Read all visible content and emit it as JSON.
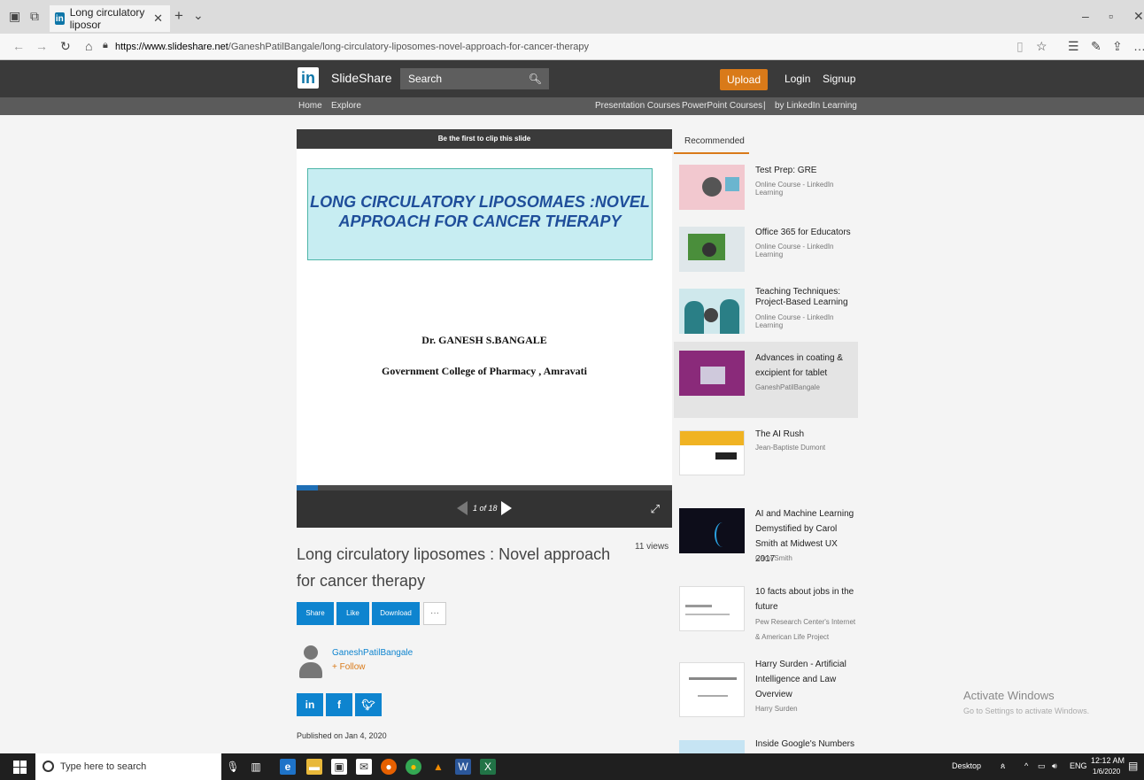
{
  "browser": {
    "tab_title": "Long circulatory liposor",
    "tab_favicon": "in",
    "url_domain": "https://www.slideshare.net",
    "url_path": "/GaneshPatilBangale/long-circulatory-liposomes-novel-approach-for-cancer-therapy"
  },
  "header": {
    "logo_badge": "in",
    "logo_text": "SlideShare",
    "search_placeholder": "Search",
    "upload_label": "Upload",
    "login_label": "Login",
    "signup_label": "Signup"
  },
  "subnav": {
    "home": "Home",
    "explore": "Explore",
    "presentation_courses": "Presentation Courses",
    "powerpoint_courses": "PowerPoint Courses",
    "linkedin_learning": "by LinkedIn Learning"
  },
  "player": {
    "clip_notice": "Be the first to clip this slide",
    "slide_title": "LONG CIRCULATORY LIPOSOMAES :NOVEL APPROACH  FOR CANCER THERAPY",
    "slide_author": "Dr. GANESH S.BANGALE",
    "slide_college": "Government College of Pharmacy , Amravati",
    "slide_counter": "1 of 18",
    "progress": 0.056
  },
  "presentation": {
    "title": "Long circulatory liposomes : Novel approach for cancer therapy",
    "views": "11 views",
    "share_label": "Share",
    "like_label": "Like",
    "download_label": "Download",
    "more_label": "···",
    "author": "GaneshPatilBangale",
    "follow_label": "+ Follow",
    "social": [
      "in",
      "f",
      "t"
    ],
    "published": "Published on Jan 4, 2020"
  },
  "recommended": {
    "heading": "Recommended",
    "items": [
      {
        "title": "Test Prep: GRE",
        "subtitle": "Online Course - LinkedIn Learning"
      },
      {
        "title": "Office 365 for Educators",
        "subtitle": "Online Course - LinkedIn Learning"
      },
      {
        "title": "Teaching Techniques: Project-Based Learning",
        "subtitle": "Online Course - LinkedIn Learning"
      },
      {
        "title": "Advances in coating & excipient for tablet",
        "subtitle": "GaneshPatilBangale"
      },
      {
        "title": "The AI Rush",
        "subtitle": "Jean-Baptiste Dumont"
      },
      {
        "title": "AI and Machine Learning Demystified by Carol Smith at Midwest UX 2017",
        "subtitle": "Carol Smith"
      },
      {
        "title": "10 facts about jobs in the future",
        "subtitle": "Pew Research Center's Internet & American Life Project"
      },
      {
        "title": "Harry Surden - Artificial Intelligence and Law Overview",
        "subtitle": "Harry Surden"
      },
      {
        "title": "Inside Google's Numbers in",
        "subtitle": ""
      }
    ]
  },
  "watermark": {
    "line1": "Activate Windows",
    "line2": "Go to Settings to activate Windows."
  },
  "taskbar": {
    "search_placeholder": "Type here to search",
    "desktop_label": "Desktop",
    "language": "ENG",
    "time": "12:12 AM",
    "date": "1/6/2020"
  },
  "colors": {
    "accent": "#0e84cf",
    "upload": "#d97a19",
    "header": "#3a3a3a"
  }
}
